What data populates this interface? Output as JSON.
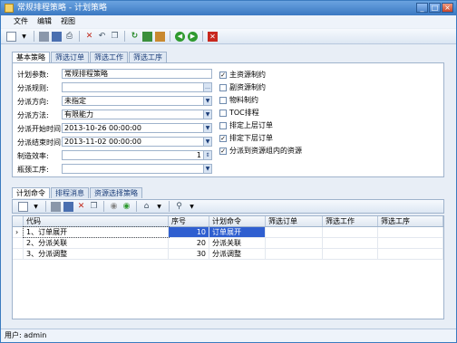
{
  "window": {
    "title": "常规排程策略 - 计划策略"
  },
  "menu": [
    "文件",
    "编辑",
    "视图"
  ],
  "toolbar": {
    "icons": [
      "new-icon",
      "dropdown-icon",
      "save-icon",
      "save-as-icon",
      "print-icon",
      "delete-icon",
      "undo-icon",
      "copy-icon",
      "refresh-icon",
      "export-icon",
      "import-icon",
      "ok-icon",
      "apply-icon",
      "close-icon"
    ]
  },
  "top_tabs": [
    "基本策略",
    "筛选订单",
    "筛选工作",
    "筛选工序"
  ],
  "form": {
    "fields": [
      {
        "label": "计划参数:",
        "value": "常规排程策略"
      },
      {
        "label": "分派规则:",
        "value": ""
      },
      {
        "label": "分派方向:",
        "value": "未指定"
      },
      {
        "label": "分派方法:",
        "value": "有限能力"
      },
      {
        "label": "分派开始时间:",
        "value": "2013-10-26 00:00:00"
      },
      {
        "label": "分派结束时间:",
        "value": "2013-11-02 00:00:00"
      },
      {
        "label": "制造效率:",
        "value": "1"
      },
      {
        "label": "瓶颈工序:",
        "value": ""
      }
    ],
    "checkboxes": [
      {
        "label": "主资源制约",
        "checked": true
      },
      {
        "label": "副资源制约",
        "checked": false
      },
      {
        "label": "物料制约",
        "checked": false
      },
      {
        "label": "TOC排程",
        "checked": false
      },
      {
        "label": "排定上层订单",
        "checked": false
      },
      {
        "label": "排定下层订单",
        "checked": true
      },
      {
        "label": "分派到资源组内的资源",
        "checked": true
      }
    ]
  },
  "bottom_tabs": [
    "计划命令",
    "排程消息",
    "资源选择策略"
  ],
  "grid": {
    "columns": [
      "代码",
      "序号",
      "计划命令",
      "筛选订单",
      "筛选工作",
      "筛选工序"
    ],
    "rows": [
      {
        "code": "1、订单展开",
        "seq": "10",
        "cmd": "订单展开",
        "selected": true
      },
      {
        "code": "2、分派关联",
        "seq": "20",
        "cmd": "分派关联",
        "selected": false
      },
      {
        "code": "3、分派调整",
        "seq": "30",
        "cmd": "分派调整",
        "selected": false
      }
    ]
  },
  "status": {
    "text": "用户: admin"
  }
}
